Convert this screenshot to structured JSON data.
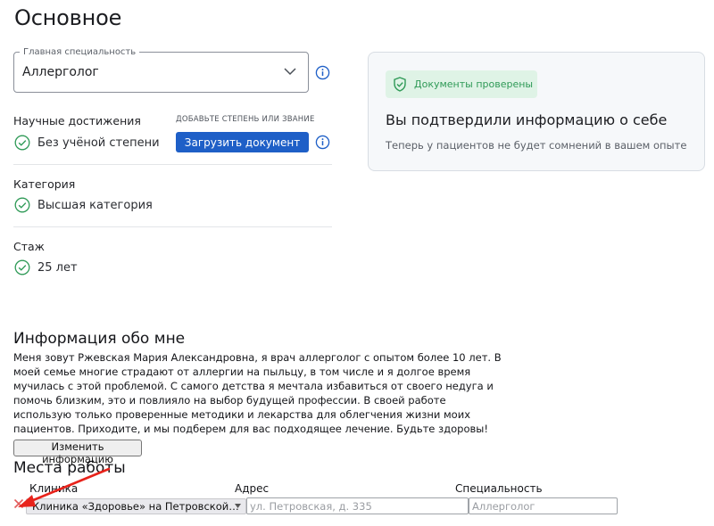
{
  "page": {
    "title": "Основное"
  },
  "specialty": {
    "legend": "Главная специальность",
    "value": "Аллерголог"
  },
  "achievements": {
    "label": "Научные достижения",
    "hint": "ДОБАВЬТЕ СТЕПЕНЬ ИЛИ ЗВАНИЕ",
    "upload_label": "Загрузить документ",
    "value": "Без учёной степени"
  },
  "category": {
    "label": "Категория",
    "value": "Высшая категория"
  },
  "experience": {
    "label": "Стаж",
    "value": "25 лет"
  },
  "verification": {
    "badge": "Документы проверены",
    "title": "Вы подтвердили информацию о себе",
    "subtitle": "Теперь у пациентов не будет сомнений в вашем опыте"
  },
  "about": {
    "title": "Информация обо мне",
    "text": "Меня зовут Ржевская Мария Александровна, я врач аллерголог с опытом более 10 лет. В моей семье многие страдают от аллергии на пыльцу, в том числе и я долгое время мучилась с этой проблемой. С самого детства я мечтала избавиться от своего недуга и помочь близким, это и повлияло на выбор будущей профессии. В своей работе использую только проверенные методики и лекарства для облегчения жизни моих пациентов. Приходите, и мы подберем для вас подходящее лечение. Будьте здоровы!",
    "edit_label": "Изменить информацию"
  },
  "workplaces": {
    "title": "Места работы",
    "columns": {
      "clinic": "Клиника",
      "address": "Адрес",
      "specialty": "Специальность"
    },
    "rows": [
      {
        "clinic": "Клиника «Здоровье» на Петровской…",
        "address_placeholder": "ул. Петровская, д. 335",
        "specialty_placeholder": "Аллерголог"
      }
    ]
  },
  "icons": {
    "chevron": "chevron-down-icon",
    "info": "info-icon",
    "check": "check-circle-icon",
    "shield": "shield-check-icon",
    "remove": "close-icon",
    "annotation": "red-arrow"
  },
  "colors": {
    "accent": "#1e5fc7",
    "success": "#2f9a57",
    "success_bg": "#dff3e6",
    "remove": "#e25b5b",
    "annotation": "#e8231b"
  }
}
